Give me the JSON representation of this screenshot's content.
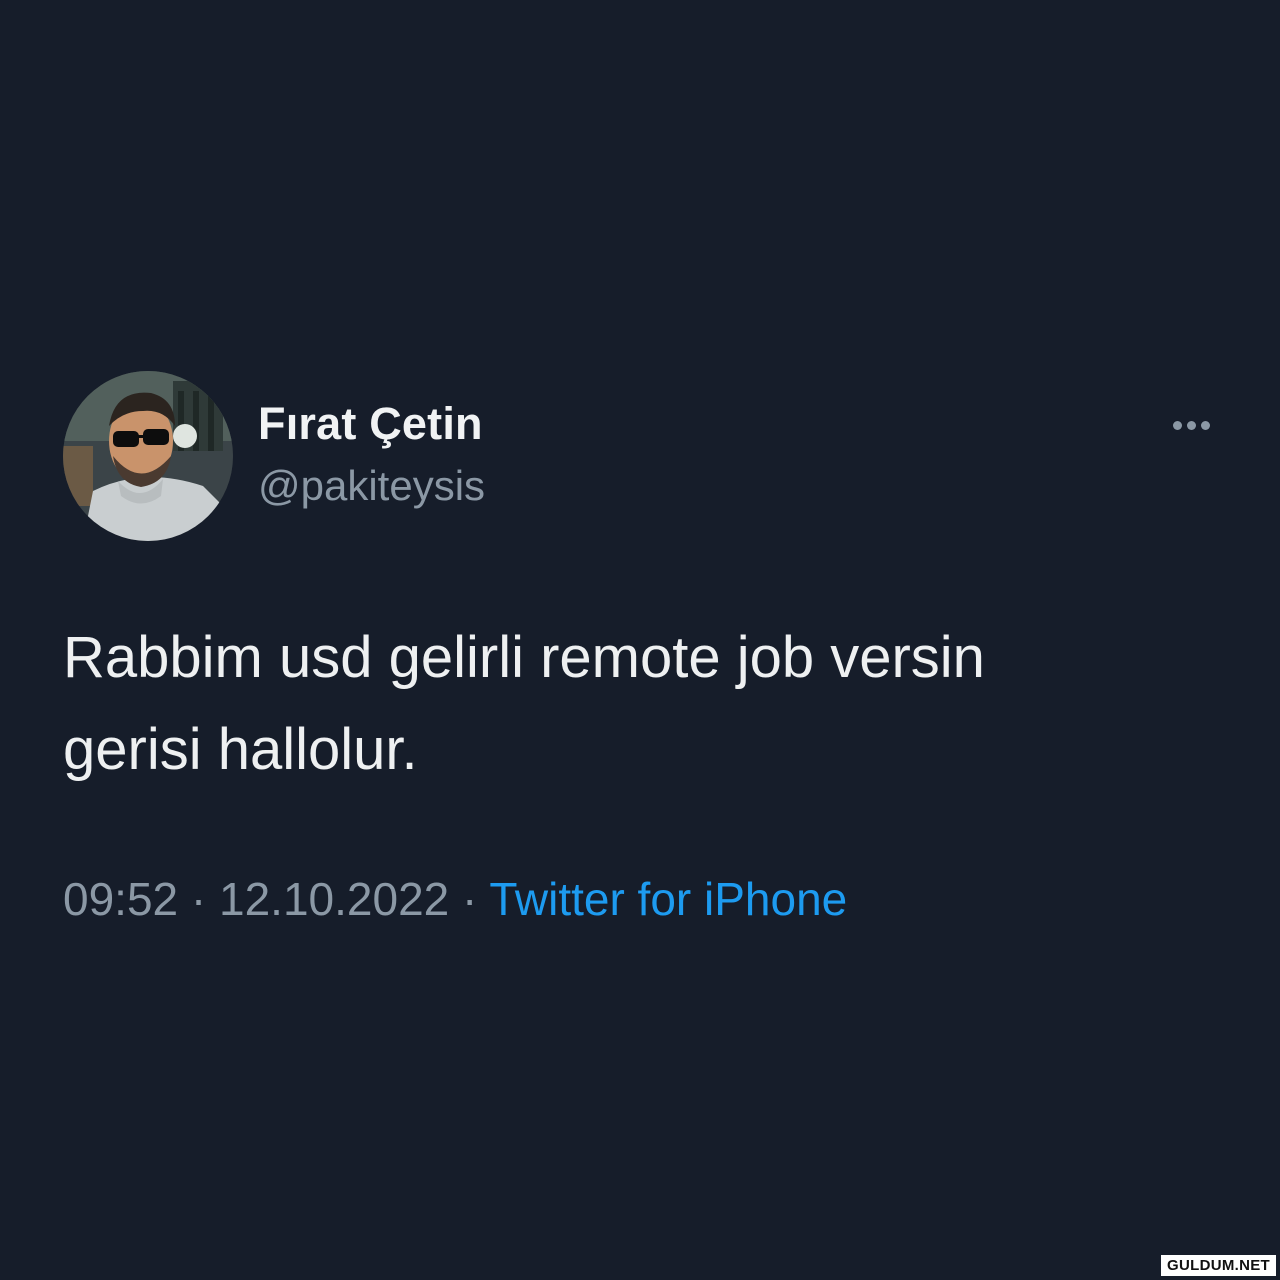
{
  "tweet": {
    "author": {
      "display_name": "Fırat Çetin",
      "handle": "@pakiteysis"
    },
    "text": "Rabbim usd gelirli remote job versin\ngerisi hallolur.",
    "time": "09:52",
    "separator": "·",
    "date": "12.10.2022",
    "source": "Twitter for iPhone"
  },
  "watermark": "GULDUM.NET",
  "colors": {
    "background": "#161d2a",
    "text": "#eef0f1",
    "secondary": "#8b98a5",
    "link": "#1d9bf0"
  },
  "icons": {
    "more": "more-horizontal-icon"
  }
}
